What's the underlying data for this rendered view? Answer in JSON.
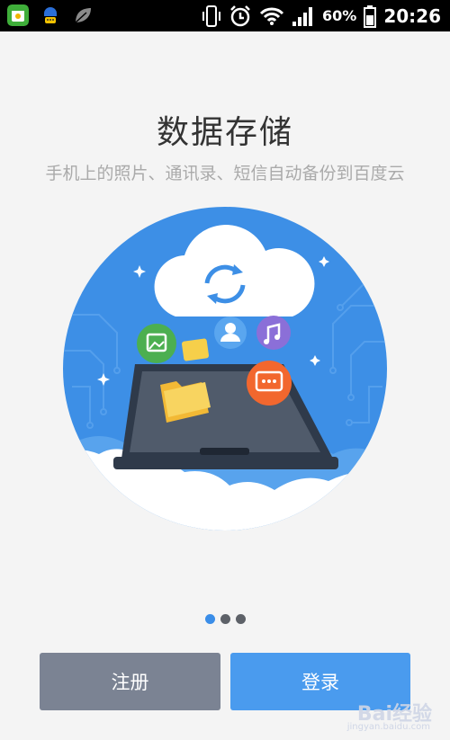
{
  "status_bar": {
    "battery_percent": "60%",
    "time": "20:26",
    "icons": [
      "app-shield-icon",
      "qq-chat-icon",
      "leaf-icon",
      "vibrate-icon",
      "alarm-icon",
      "wifi-icon",
      "signal-icon",
      "battery-icon"
    ]
  },
  "intro": {
    "title": "数据存储",
    "subtitle": "手机上的照片、通讯录、短信自动备份到百度云"
  },
  "pager": {
    "current_page": 1,
    "page_count": 3
  },
  "actions": {
    "register_label": "注册",
    "login_label": "登录"
  },
  "watermark": {
    "brand": "Bai经验",
    "url": "jingyan.baidu.com"
  },
  "colors": {
    "accent_blue": "#4a9bee",
    "register_gray": "#7b8393",
    "circle_blue": "#3d8fe6"
  }
}
